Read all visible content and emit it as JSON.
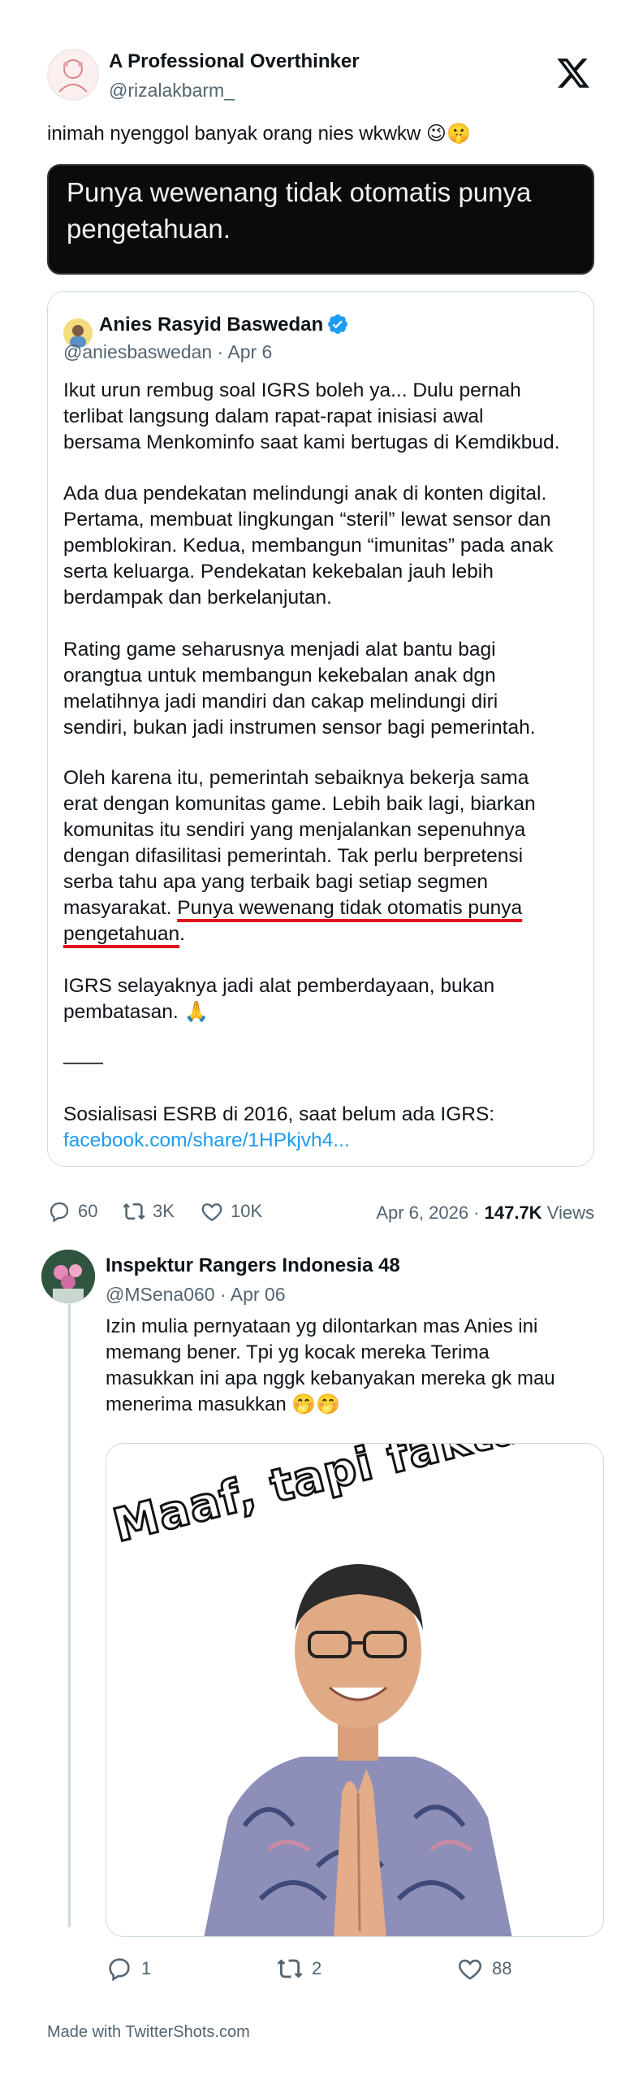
{
  "main_tweet": {
    "author_name": "A Professional Overthinker",
    "handle": "@rizalakbarm_",
    "text": "inimah nyenggol banyak orang nies wkwkw 😉🤫",
    "highlight_lines": [
      "Punya wewenang tidak otomatis punya",
      "pengetahuan."
    ],
    "reply_count": "60",
    "retweet_count": "3K",
    "like_count": "10K",
    "date": "Apr 6, 2026 ·",
    "views_count": "147.7K",
    "views_label": "Views"
  },
  "quoted_tweet": {
    "author_name": "Anies Rasyid Baswedan",
    "handle": "@aniesbaswedan",
    "date": "· Apr 6",
    "paragraphs": [
      [
        "Ikut urun rembug soal IGRS boleh ya... Dulu pernah",
        "terlibat langsung dalam rapat-rapat inisiasi awal",
        "bersama Menkominfo saat kami bertugas di Kemdikbud."
      ],
      [
        "Ada dua pendekatan melindungi anak di konten digital.",
        "Pertama, membuat lingkungan “steril” lewat sensor dan",
        "pemblokiran. Kedua, membangun “imunitas” pada anak",
        "serta keluarga. Pendekatan kekebalan jauh lebih",
        "berdampak dan berkelanjutan."
      ],
      [
        "Rating game seharusnya menjadi alat bantu bagi",
        "orangtua untuk membangun kekebalan anak dgn",
        "melatihnya jadi mandiri dan cakap melindungi diri",
        "sendiri, bukan jadi instrumen sensor bagi pemerintah."
      ],
      [
        "Oleh karena itu, pemerintah sebaiknya bekerja sama",
        "erat dengan komunitas game. Lebih baik lagi, biarkan",
        "komunitas itu sendiri yang menjalankan sepenuhnya",
        "dengan difasilitasi pemerintah. Tak perlu berpretensi",
        "serba tahu apa yang terbaik bagi setiap segmen"
      ],
      [
        "IGRS selayaknya jadi alat pemberdayaan, bukan",
        "pembatasan. 🙏"
      ]
    ],
    "para4_last_prefix": "masyarakat. ",
    "para4_last_underlined": "Punya wewenang tidak otomatis punya",
    "para4_final_underlined": "pengetahuan",
    "para4_final_suffix": ".",
    "divider": "——",
    "footer_text": "Sosialisasi ESRB di 2016, saat belum ada IGRS:",
    "footer_link": "facebook.com/share/1HPkjvh4..."
  },
  "reply_tweet": {
    "author_name": "Inspektur Rangers Indonesia 48",
    "handle": "@MSena060",
    "date": "· Apr 06",
    "lines": [
      "Izin mulia pernyataan yg dilontarkan mas Anies ini",
      "memang bener. Tpi yg kocak mereka Terima",
      "masukkan ini apa nggk kebanyakan mereka gk mau",
      "menerima masukkan 🤭🤭"
    ],
    "meme_caption": "Maaf, tapi fakta...",
    "reply_count": "1",
    "retweet_count": "2",
    "like_count": "88"
  },
  "footer": {
    "credit": "Made with TwitterShots.com"
  },
  "colors": {
    "verified": "#1d9bf0",
    "link": "#1d9bf0",
    "underline": "#e0141e",
    "muted": "#536471"
  }
}
